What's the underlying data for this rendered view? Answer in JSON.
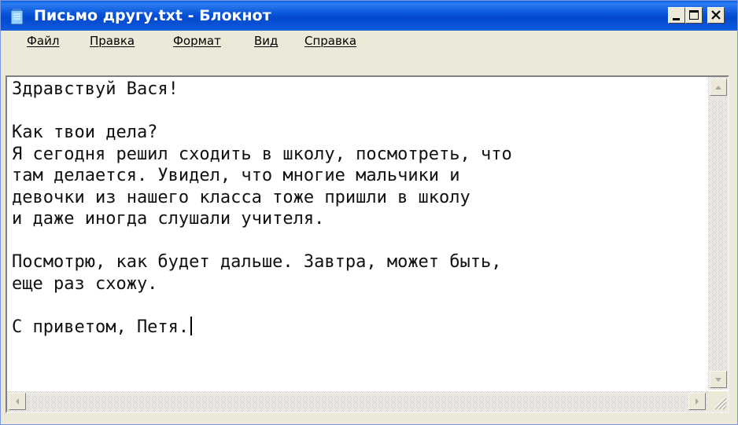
{
  "window": {
    "title": "Письмо другу.txt - Блокнот",
    "icon": "notepad-icon"
  },
  "title_buttons": {
    "minimize": "minimize-icon",
    "maximize": "maximize-icon",
    "close": "close-icon"
  },
  "menu": {
    "items": [
      {
        "label": "Файл"
      },
      {
        "label": "Правка"
      },
      {
        "label": "Формат"
      },
      {
        "label": "Вид"
      },
      {
        "label": "Справка"
      }
    ]
  },
  "document": {
    "lines": [
      "Здравствуй Вася!",
      "",
      "Как твои дела?",
      "Я сегодня решил сходить в школу, посмотреть, что",
      "там делается. Увидел, что многие мальчики и",
      "девочки из нашего класса тоже пришли в школу",
      "и даже иногда слушали учителя.",
      "",
      "Посмотрю, как будет дальше. Завтра, может быть,",
      "еще раз схожу.",
      "",
      "С приветом, Петя."
    ]
  },
  "colors": {
    "titlebar": "#0753d9",
    "window_bg": "#ece9d8",
    "text_bg": "#ffffff"
  }
}
